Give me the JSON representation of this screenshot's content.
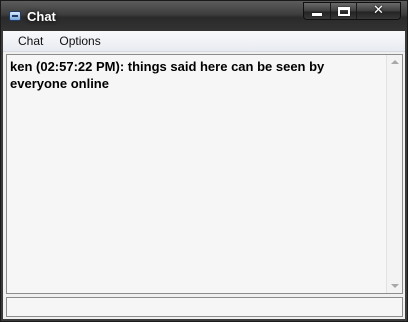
{
  "window": {
    "title": "Chat",
    "close_glyph": "✕"
  },
  "icons": {
    "app": "chat-app-icon",
    "minimize": "minimize-icon",
    "maximize": "maximize-icon",
    "close": "close-icon"
  },
  "menu": {
    "items": [
      {
        "label": "Chat"
      },
      {
        "label": "Options"
      }
    ]
  },
  "chat": {
    "messages": [
      {
        "text": "ken (02:57:22 PM): things said here can be seen by everyone online"
      }
    ]
  },
  "input": {
    "value": "",
    "placeholder": ""
  }
}
